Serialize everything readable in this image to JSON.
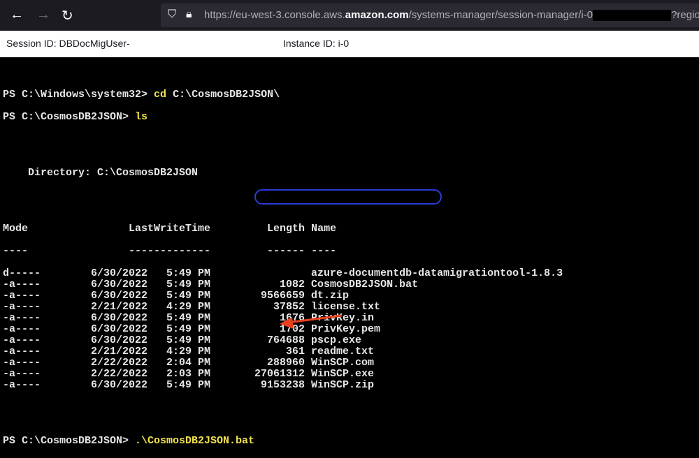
{
  "browser": {
    "url_prefix": "https://eu-west-3.console.aws.",
    "url_domain": "amazon.com",
    "url_path": "/systems-manager/session-manager/i-0",
    "url_suffix": "?region="
  },
  "session": {
    "session_id": "Session ID: DBDocMigUser-",
    "instance_id": "Instance ID: i-0"
  },
  "terminal": {
    "prompt1": "PS C:\\Windows\\system32> ",
    "cmd1": "cd",
    "arg1": " C:\\CosmosDB2JSON\\",
    "prompt2": "PS C:\\CosmosDB2JSON> ",
    "cmd2": "ls",
    "directory": "    Directory: C:\\CosmosDB2JSON",
    "headers": {
      "mode": "Mode",
      "lwt": "LastWriteTime",
      "length": "Length",
      "name": "Name"
    },
    "dashes": {
      "mode": "----",
      "lwt": "-------------",
      "length": "------",
      "name": "----"
    },
    "rows": [
      {
        "mode": "d-----",
        "date": "6/30/2022",
        "time": "5:49 PM",
        "length": "",
        "name": "azure-documentdb-datamigrationtool-1.8.3"
      },
      {
        "mode": "-a----",
        "date": "6/30/2022",
        "time": "5:49 PM",
        "length": "1082",
        "name": "CosmosDB2JSON.bat"
      },
      {
        "mode": "-a----",
        "date": "6/30/2022",
        "time": "5:49 PM",
        "length": "9566659",
        "name": "dt.zip"
      },
      {
        "mode": "-a----",
        "date": "2/21/2022",
        "time": "4:29 PM",
        "length": "37852",
        "name": "license.txt"
      },
      {
        "mode": "-a----",
        "date": "6/30/2022",
        "time": "5:49 PM",
        "length": "1676",
        "name": "PrivKey.in"
      },
      {
        "mode": "-a----",
        "date": "6/30/2022",
        "time": "5:49 PM",
        "length": "1702",
        "name": "PrivKey.pem"
      },
      {
        "mode": "-a----",
        "date": "6/30/2022",
        "time": "5:49 PM",
        "length": "764688",
        "name": "pscp.exe"
      },
      {
        "mode": "-a----",
        "date": "2/21/2022",
        "time": "4:29 PM",
        "length": "361",
        "name": "readme.txt"
      },
      {
        "mode": "-a----",
        "date": "2/22/2022",
        "time": "2:04 PM",
        "length": "288960",
        "name": "WinSCP.com"
      },
      {
        "mode": "-a----",
        "date": "2/22/2022",
        "time": "2:03 PM",
        "length": "27061312",
        "name": "WinSCP.exe"
      },
      {
        "mode": "-a----",
        "date": "6/30/2022",
        "time": "5:49 PM",
        "length": "9153238",
        "name": "WinSCP.zip"
      }
    ],
    "prompt3": "PS C:\\CosmosDB2JSON> ",
    "cmd3": ".\\CosmosDB2JSON.bat"
  },
  "colors": {
    "highlight_ellipse": "#2a3bd6",
    "arrow": "#e8401c",
    "command": "#f2e34c"
  }
}
